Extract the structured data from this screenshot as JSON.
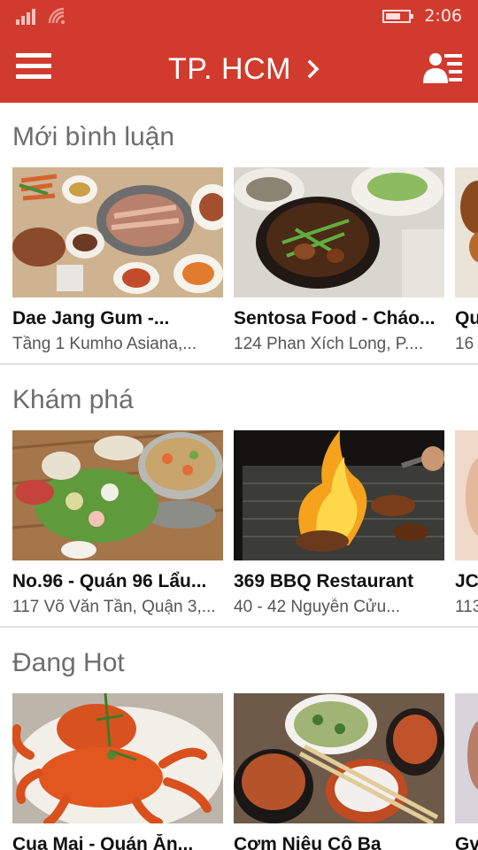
{
  "status_bar": {
    "time": "2:06",
    "icons": [
      "signal-icon",
      "wifi-icon",
      "battery-icon"
    ],
    "battery_level": 0.65
  },
  "app_bar": {
    "title": "TP. HCM",
    "icons": [
      "hamburger-menu-icon",
      "chevron-right-icon",
      "account-list-icon"
    ],
    "color": "#d13b2e"
  },
  "sections": [
    {
      "title": "Mới bình luận",
      "cards": [
        {
          "name": "Dae Jang Gum -...",
          "address": "Tầng 1 Kumho Asiana,..."
        },
        {
          "name": "Sentosa Food - Cháo...",
          "address": "124 Phan Xích Long, P...."
        },
        {
          "name": "Qu",
          "address": "16"
        }
      ]
    },
    {
      "title": "Khám phá",
      "cards": [
        {
          "name": "No.96 - Quán 96 Lẩu...",
          "address": "117 Võ Văn Tần, Quận 3,..."
        },
        {
          "name": "369 BBQ Restaurant",
          "address": "40 - 42 Nguyễn Cửu..."
        },
        {
          "name": "JC",
          "address": "113"
        }
      ]
    },
    {
      "title": "Đang Hot",
      "cards": [
        {
          "name": "Cua Mai - Quán Ăn...",
          "address": ""
        },
        {
          "name": "Cơm Niêu Cô Ba",
          "address": ""
        },
        {
          "name": "Gv",
          "address": ""
        }
      ]
    }
  ]
}
